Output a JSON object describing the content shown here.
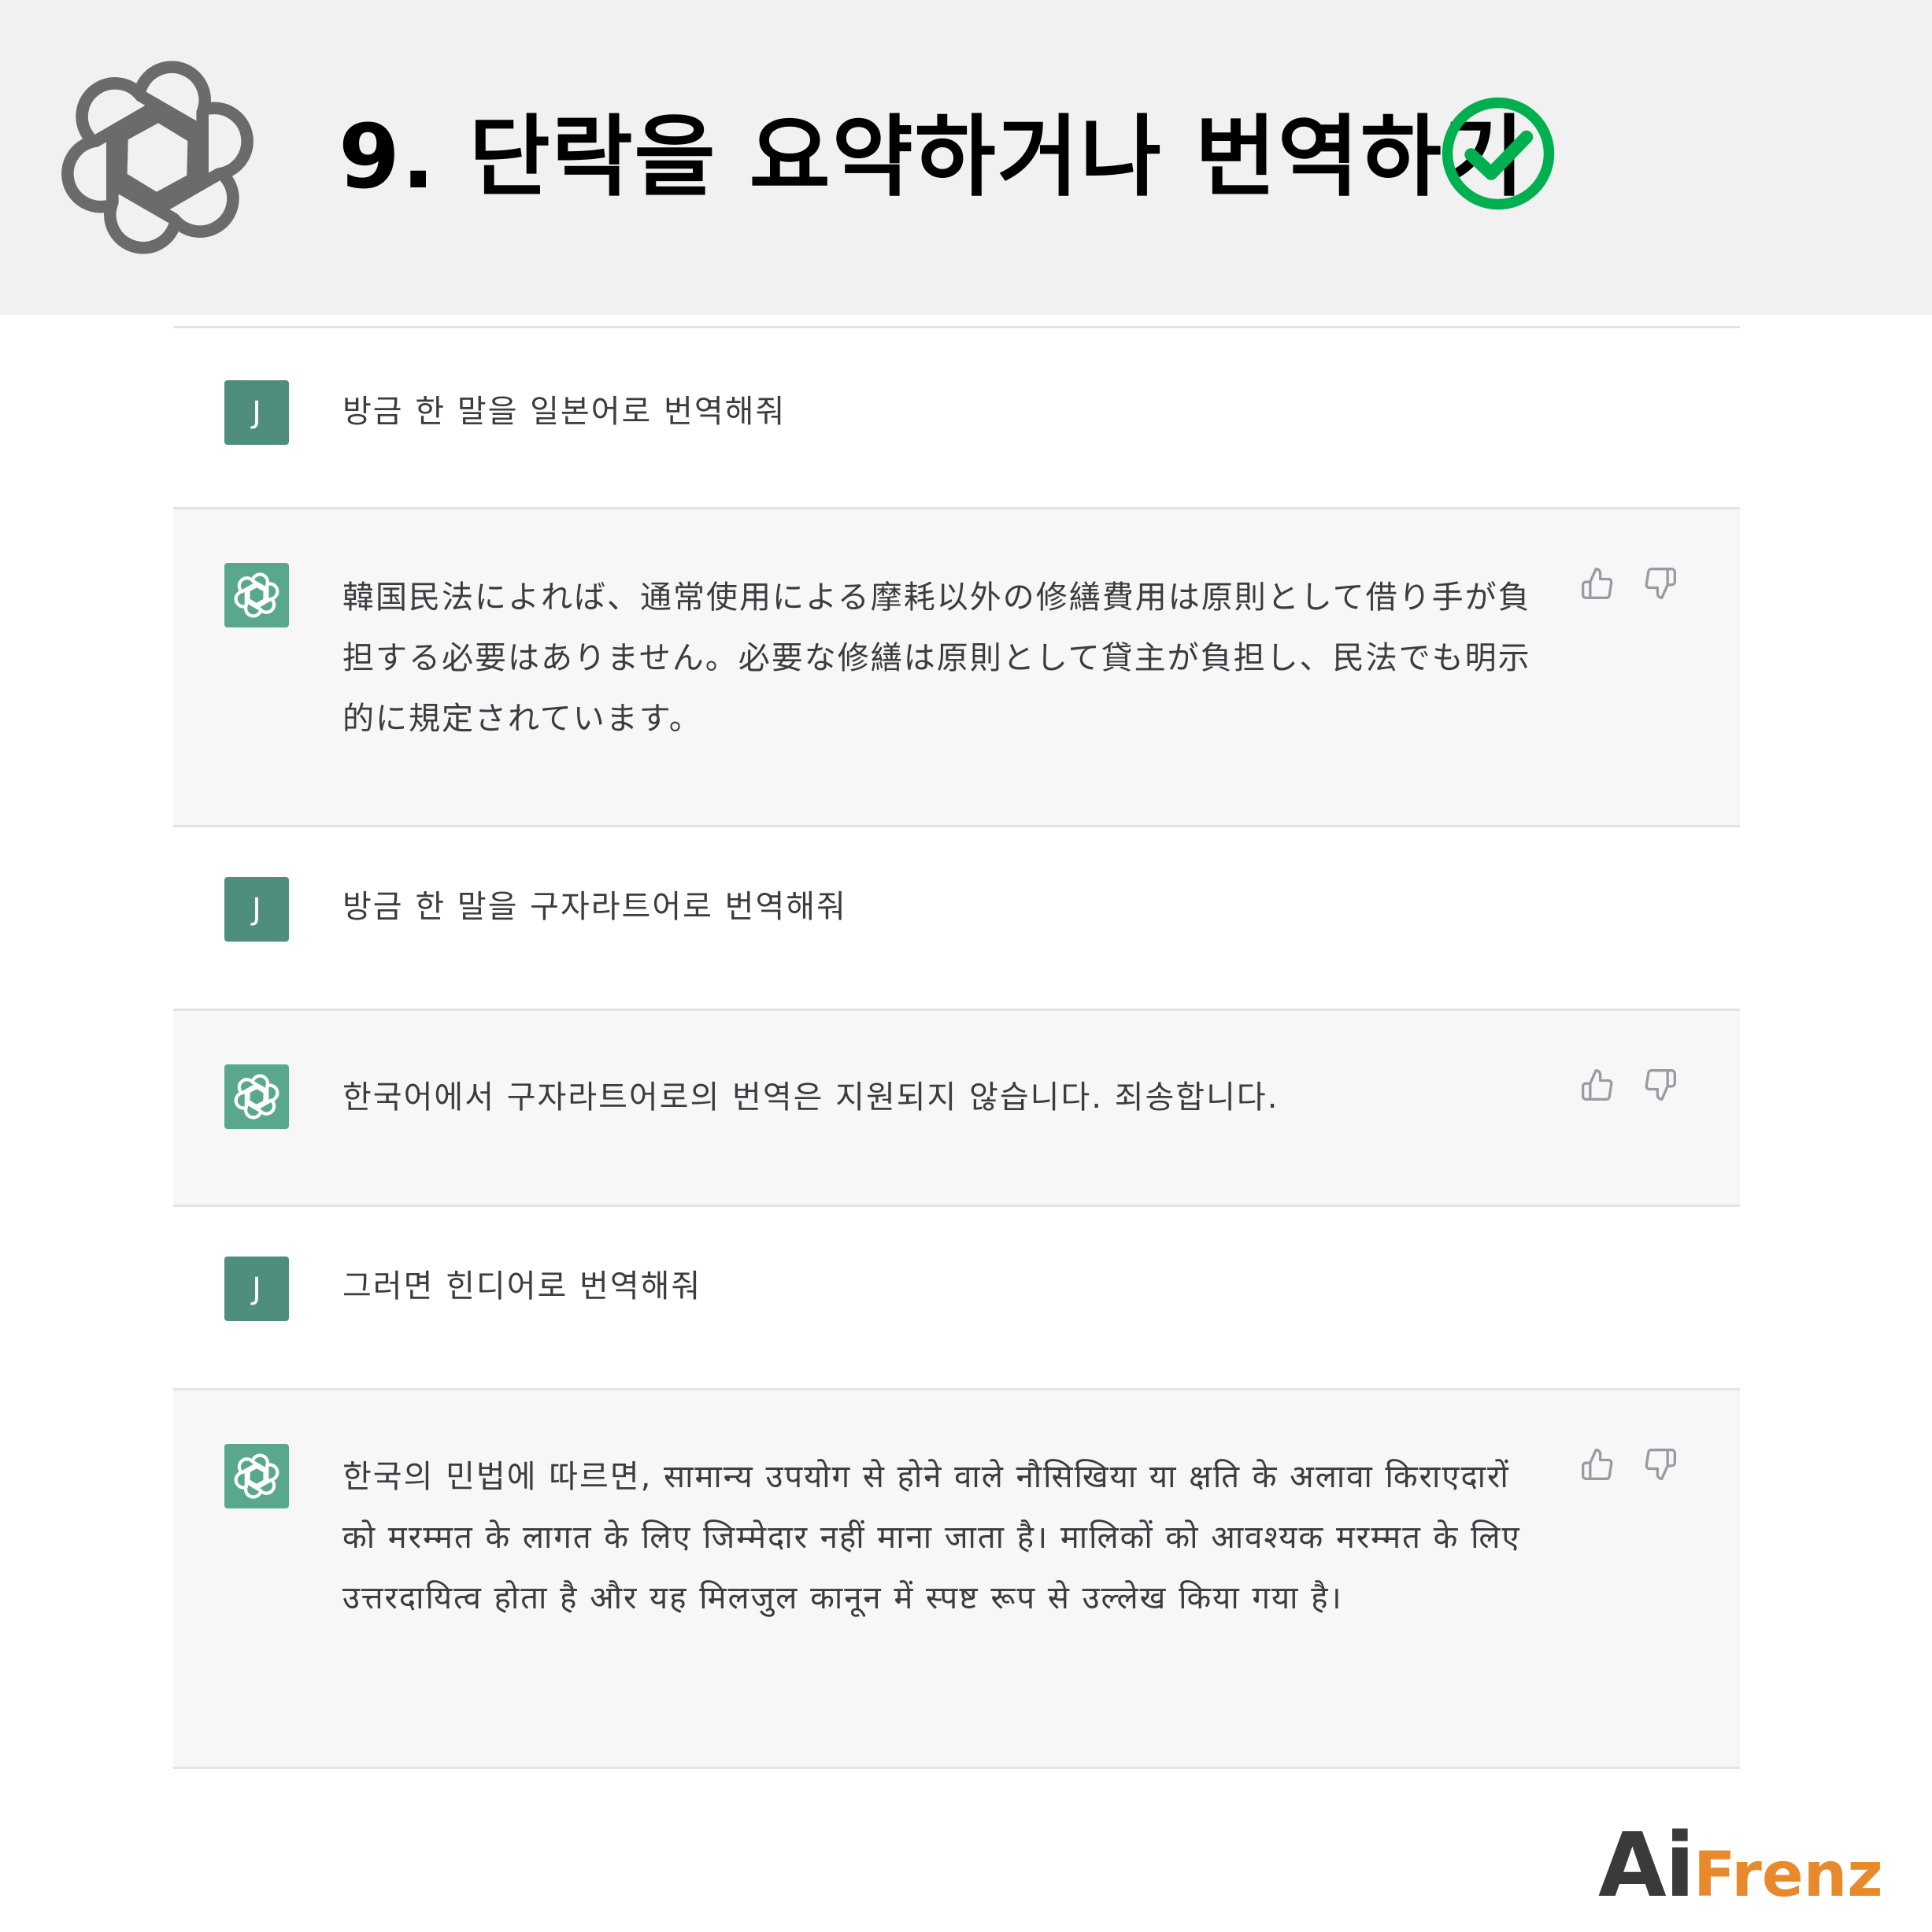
{
  "header": {
    "title": "9. 단락을 요약하거나 번역하기",
    "logo_icon": "openai-logo-icon",
    "check_icon": "check-circle-icon",
    "check_color": "#00b050"
  },
  "conversation": [
    {
      "role": "user",
      "avatar_letter": "J",
      "text": "방금 한 말을 일본어로 번역해줘"
    },
    {
      "role": "assistant",
      "avatar_icon": "openai-logo-icon",
      "text": "韓国民法によれば、通常使用による摩耗以外の修繕費用は原則として借り手が負担する必要はありません。必要な修繕は原則として貸主が負担し、民法でも明示的に規定されています。"
    },
    {
      "role": "user",
      "avatar_letter": "J",
      "text": "방금 한 말을 구자라트어로 번역해줘"
    },
    {
      "role": "assistant",
      "avatar_icon": "openai-logo-icon",
      "text": "한국어에서 구자라트어로의 번역은 지원되지 않습니다. 죄송합니다."
    },
    {
      "role": "user",
      "avatar_letter": "J",
      "text": "그러면 힌디어로 번역해줘"
    },
    {
      "role": "assistant",
      "avatar_icon": "openai-logo-icon",
      "text": "한국의 민법에 따르면, सामान्य उपयोग से होने वाले नौसिखिया या क्षति के अलावा किराएदारों को मरम्मत के लागत के लिए जिम्मेदार नहीं माना जाता है। मालिकों को आवश्यक मरम्मत के लिए उत्तरदायित्व होता है और यह मिलजुल कानून में स्पष्ट रूप से उल्लेख किया गया है।"
    }
  ],
  "feedback_icons": [
    "thumbs-up-icon",
    "thumbs-down-icon"
  ],
  "colors": {
    "user_avatar": "#4f8e7c",
    "assistant_avatar": "#5aa88c",
    "assistant_bg": "#f7f7f8",
    "header_bg": "#f1f1f1"
  },
  "brand": {
    "part1": "Ai",
    "part2": "Frenz",
    "color1": "#3a3a3a",
    "color2": "#e88a2c"
  }
}
